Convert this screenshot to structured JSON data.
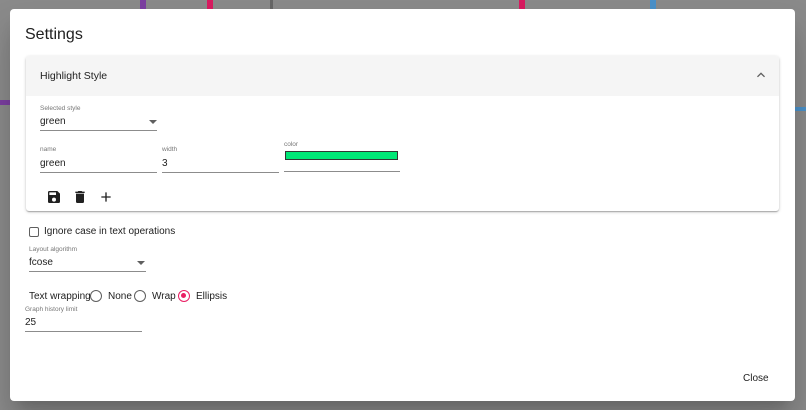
{
  "dialog": {
    "title": "Settings",
    "close_label": "Close"
  },
  "highlight_panel": {
    "title": "Highlight Style",
    "toggle_icon": "chevron-up-icon",
    "selected_style": {
      "label": "Selected style",
      "value": "green"
    },
    "name": {
      "label": "name",
      "value": "green"
    },
    "width": {
      "label": "width",
      "value": "3"
    },
    "color": {
      "label": "color",
      "value": "#00e676"
    },
    "actions": [
      "save-icon",
      "delete-icon",
      "add-icon"
    ]
  },
  "options": {
    "ignore_case": {
      "label": "Ignore case in text operations",
      "checked": false
    },
    "layout_algorithm": {
      "label": "Layout algorithm",
      "value": "fcose"
    },
    "text_wrapping": {
      "label": "Text wrapping",
      "options": [
        "None",
        "Wrap",
        "Ellipsis"
      ],
      "selected": "Ellipsis"
    },
    "graph_history_limit": {
      "label": "Graph history limit",
      "value": "25"
    }
  },
  "colors": {
    "accent": "#e91e63",
    "swatch": "#00e676"
  }
}
